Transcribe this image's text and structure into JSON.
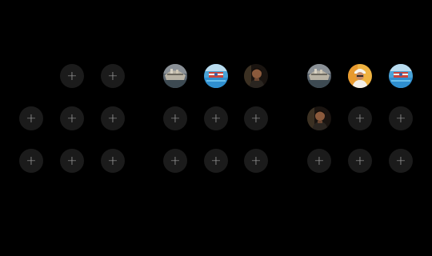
{
  "add_symbol": "+",
  "groups": [
    {
      "name": "group-1",
      "rows": [
        [
          "none",
          "empty",
          "empty"
        ],
        [
          "empty",
          "empty",
          "empty"
        ],
        [
          "empty",
          "empty",
          "empty"
        ]
      ]
    },
    {
      "name": "group-2",
      "rows": [
        [
          "photo-boat",
          "photo-pool-flag",
          "photo-man-dark"
        ],
        [
          "empty",
          "empty",
          "empty"
        ],
        [
          "empty",
          "empty",
          "empty"
        ]
      ]
    },
    {
      "name": "group-3",
      "rows": [
        [
          "photo-boat",
          "photo-person-white-cap",
          "photo-pool-flag"
        ],
        [
          "photo-man-dark",
          "empty",
          "empty"
        ],
        [
          "empty",
          "empty",
          "empty"
        ]
      ]
    }
  ],
  "colors": {
    "background": "#000000",
    "slot": "#1b1b1b",
    "plus": "#9a9a9a"
  }
}
